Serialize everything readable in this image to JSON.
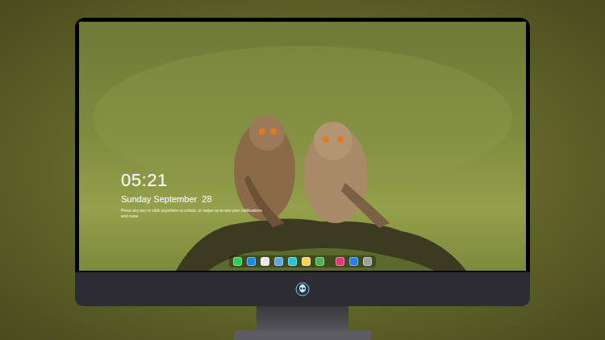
{
  "lock_screen": {
    "time": "05:21",
    "date": "Sunday September  28",
    "hint": "Press any key or click anywhere to unlock, or swipe up to see your notifications and more"
  },
  "dock": {
    "groups": [
      [
        {
          "name": "messages",
          "color": "#34c759"
        },
        {
          "name": "mail",
          "color": "#1e88e5"
        },
        {
          "name": "safari",
          "color": "#e8e8e8"
        },
        {
          "name": "finder",
          "color": "#5aa7e8"
        },
        {
          "name": "video",
          "color": "#26c6da"
        },
        {
          "name": "notes",
          "color": "#f7d35a"
        },
        {
          "name": "photos",
          "color": "#4caf50"
        }
      ],
      [
        {
          "name": "music",
          "color": "#e3367a"
        },
        {
          "name": "app-store",
          "color": "#2f7bf5"
        },
        {
          "name": "camera",
          "color": "#9e9e9e"
        }
      ]
    ]
  }
}
